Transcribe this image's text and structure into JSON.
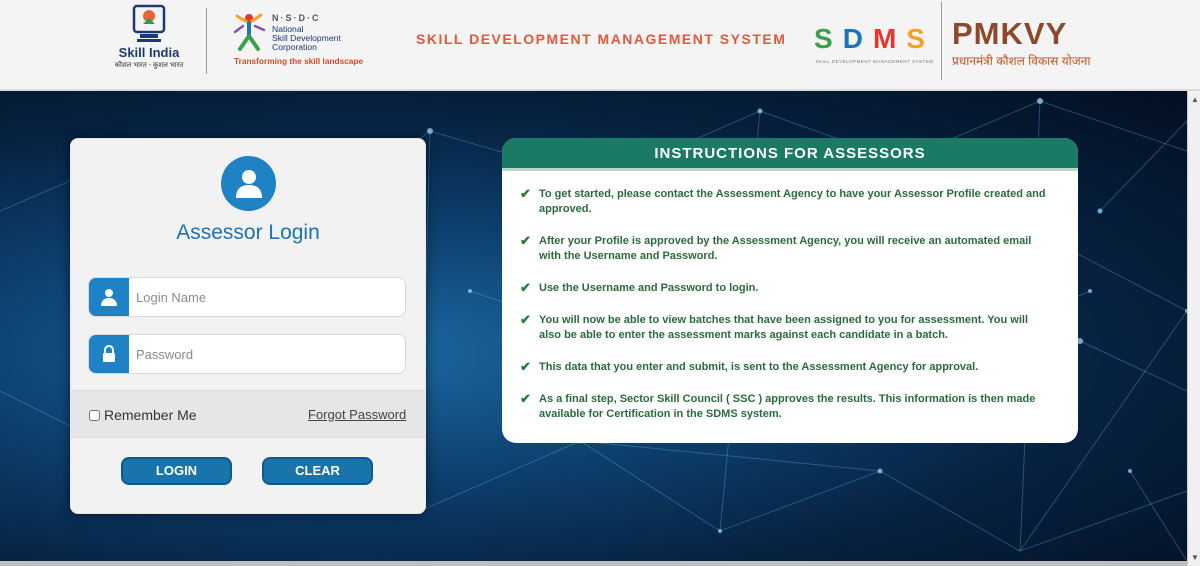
{
  "header": {
    "skill_india": {
      "name": "Skill India",
      "tagline": "कौशल भारत - कुशल भारत"
    },
    "nsdc": {
      "abbr": "N·S·D·C",
      "line1": "National",
      "line2": "Skill Development",
      "line3": "Corporation",
      "slogan": "Transforming the skill landscape"
    },
    "system_title": "SKILL DEVELOPMENT MANAGEMENT SYSTEM",
    "sdms": {
      "letters": [
        "S",
        "D",
        "M",
        "S"
      ],
      "subtitle": "SKILL DEVELOPMENT MANAGEMENT SYSTEM"
    },
    "pmkvy": {
      "name": "PMKVY",
      "subtitle": "प्रधानमंत्री कौशल विकास योजना"
    }
  },
  "login": {
    "title": "Assessor Login",
    "username_placeholder": "Login Name",
    "username_value": "",
    "password_placeholder": "Password",
    "password_value": "",
    "remember_label": "Remember Me",
    "remember_checked": false,
    "forgot_label": "Forgot Password",
    "login_button": "LOGIN",
    "clear_button": "CLEAR"
  },
  "instructions": {
    "title": "INSTRUCTIONS FOR ASSESSORS",
    "items": [
      "To get started, please contact the Assessment Agency to have your Assessor Profile created and approved.",
      "After your Profile is approved by the Assessment Agency, you will receive an automated email with the Username and Password.",
      "Use the Username and Password to login.",
      "You will now be able to view batches that have been assigned to you for assessment. You will also be able to enter the assessment marks against each candidate in a batch.",
      "This data that you enter and submit, is sent to the Assessment Agency for approval.",
      "As a final step, Sector Skill Council ( SSC ) approves the results. This information is then made available for Certification in the SDMS system."
    ]
  },
  "colors": {
    "accent_blue": "#1f82c4",
    "instructions_header": "#1b7a66",
    "instruction_text": "#2a6b3d",
    "title_orange": "#e3583c"
  }
}
